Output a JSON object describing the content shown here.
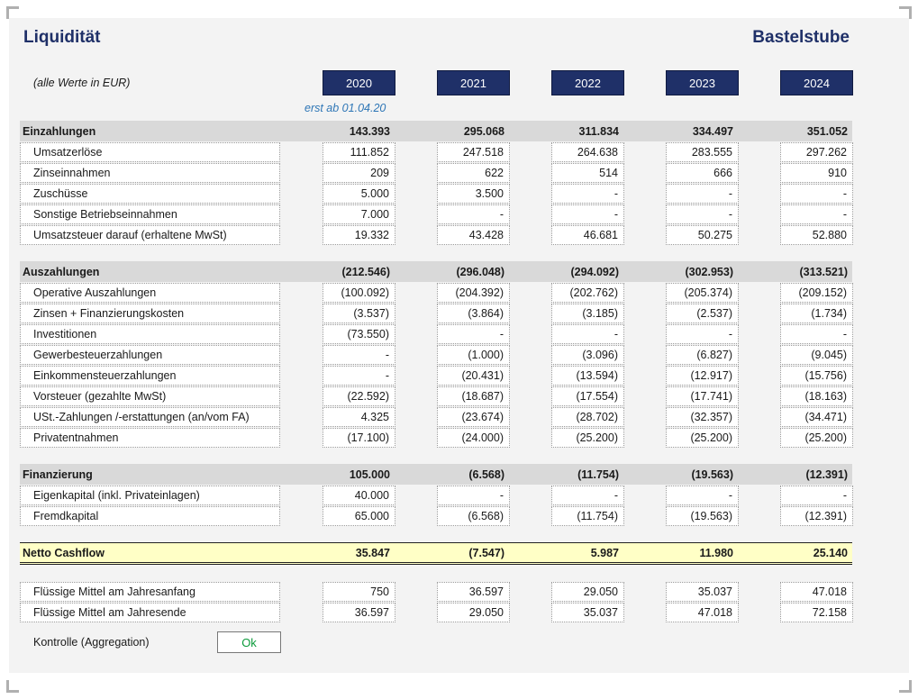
{
  "title": "Liquidität",
  "company": "Bastelstube",
  "unit_note": "(alle Werte in EUR)",
  "years": [
    "2020",
    "2021",
    "2022",
    "2023",
    "2024"
  ],
  "year_note": "erst ab 01.04.20",
  "sections": [
    {
      "header": {
        "label": "Einzahlungen",
        "values": [
          "143.393",
          "295.068",
          "311.834",
          "334.497",
          "351.052"
        ]
      },
      "rows": [
        {
          "label": "Umsatzerlöse",
          "values": [
            "111.852",
            "247.518",
            "264.638",
            "283.555",
            "297.262"
          ]
        },
        {
          "label": "Zinseinnahmen",
          "values": [
            "209",
            "622",
            "514",
            "666",
            "910"
          ]
        },
        {
          "label": "Zuschüsse",
          "values": [
            "5.000",
            "3.500",
            "-",
            "-",
            "-"
          ]
        },
        {
          "label": "Sonstige Betriebseinnahmen",
          "values": [
            "7.000",
            "-",
            "-",
            "-",
            "-"
          ]
        },
        {
          "label": "Umsatzsteuer darauf (erhaltene MwSt)",
          "values": [
            "19.332",
            "43.428",
            "46.681",
            "50.275",
            "52.880"
          ]
        }
      ]
    },
    {
      "header": {
        "label": "Auszahlungen",
        "values": [
          "(212.546)",
          "(296.048)",
          "(294.092)",
          "(302.953)",
          "(313.521)"
        ]
      },
      "rows": [
        {
          "label": "Operative Auszahlungen",
          "values": [
            "(100.092)",
            "(204.392)",
            "(202.762)",
            "(205.374)",
            "(209.152)"
          ]
        },
        {
          "label": "Zinsen + Finanzierungskosten",
          "values": [
            "(3.537)",
            "(3.864)",
            "(3.185)",
            "(2.537)",
            "(1.734)"
          ]
        },
        {
          "label": "Investitionen",
          "values": [
            "(73.550)",
            "-",
            "-",
            "-",
            "-"
          ]
        },
        {
          "label": "Gewerbesteuerzahlungen",
          "values": [
            "-",
            "(1.000)",
            "(3.096)",
            "(6.827)",
            "(9.045)"
          ]
        },
        {
          "label": "Einkommensteuerzahlungen",
          "values": [
            "-",
            "(20.431)",
            "(13.594)",
            "(12.917)",
            "(15.756)"
          ]
        },
        {
          "label": "Vorsteuer (gezahlte MwSt)",
          "values": [
            "(22.592)",
            "(18.687)",
            "(17.554)",
            "(17.741)",
            "(18.163)"
          ]
        },
        {
          "label": "USt.-Zahlungen /-erstattungen (an/vom FA)",
          "values": [
            "4.325",
            "(23.674)",
            "(28.702)",
            "(32.357)",
            "(34.471)"
          ]
        },
        {
          "label": "Privatentnahmen",
          "values": [
            "(17.100)",
            "(24.000)",
            "(25.200)",
            "(25.200)",
            "(25.200)"
          ]
        }
      ]
    },
    {
      "header": {
        "label": "Finanzierung",
        "values": [
          "105.000",
          "(6.568)",
          "(11.754)",
          "(19.563)",
          "(12.391)"
        ]
      },
      "rows": [
        {
          "label": "Eigenkapital (inkl. Privateinlagen)",
          "values": [
            "40.000",
            "-",
            "-",
            "-",
            "-"
          ]
        },
        {
          "label": "Fremdkapital",
          "values": [
            "65.000",
            "(6.568)",
            "(11.754)",
            "(19.563)",
            "(12.391)"
          ]
        }
      ]
    }
  ],
  "netto": {
    "label": "Netto Cashflow",
    "values": [
      "35.847",
      "(7.547)",
      "5.987",
      "11.980",
      "25.140"
    ]
  },
  "liquid": [
    {
      "label": "Flüssige Mittel am Jahresanfang",
      "values": [
        "750",
        "36.597",
        "29.050",
        "35.037",
        "47.018"
      ]
    },
    {
      "label": "Flüssige Mittel am Jahresende",
      "values": [
        "36.597",
        "29.050",
        "35.037",
        "47.018",
        "72.158"
      ]
    }
  ],
  "kontrolle": {
    "label": "Kontrolle (Aggregation)",
    "status": "Ok",
    "status_color": "#0b9a3a"
  },
  "colors": {
    "accent": "#1f3068",
    "header_bg": "#d9d9d9",
    "netto_bg": "#ffffc6",
    "note": "#2e76b6"
  }
}
